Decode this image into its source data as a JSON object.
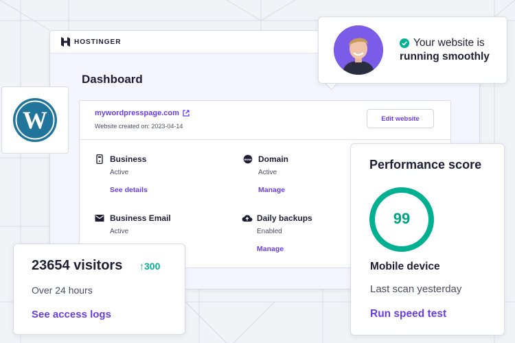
{
  "brand": {
    "name": "HOSTINGER"
  },
  "dashboard": {
    "title": "Dashboard",
    "site": {
      "domain": "mywordpresspage.com",
      "created": "Website created on: 2023-04-14",
      "edit_label": "Edit website"
    },
    "services": [
      {
        "title": "Business",
        "status": "Active",
        "link": "See details",
        "icon": "server-icon"
      },
      {
        "title": "Domain",
        "status": "Active",
        "link": "Manage",
        "icon": "www-icon"
      },
      {
        "title": "Business Email",
        "status": "Active",
        "link": "",
        "icon": "mail-icon"
      },
      {
        "title": "Daily backups",
        "status": "Enabled",
        "link": "Manage",
        "icon": "cloud-upload-icon"
      }
    ]
  },
  "status_bubble": {
    "line1": "Your website is",
    "line2": "running smoothly",
    "icon": "check-circle-icon"
  },
  "visitors": {
    "count": "23654 visitors",
    "delta": "300",
    "period": "Over 24 hours",
    "link": "See access logs"
  },
  "performance": {
    "title": "Performance score",
    "score": "99",
    "score_fraction": 0.99,
    "device": "Mobile device",
    "last_scan": "Last scan yesterday",
    "link": "Run speed test"
  },
  "colors": {
    "accent": "#673de6",
    "success": "#00b090",
    "text": "#1d1e35",
    "wordpress": "#21759b"
  }
}
